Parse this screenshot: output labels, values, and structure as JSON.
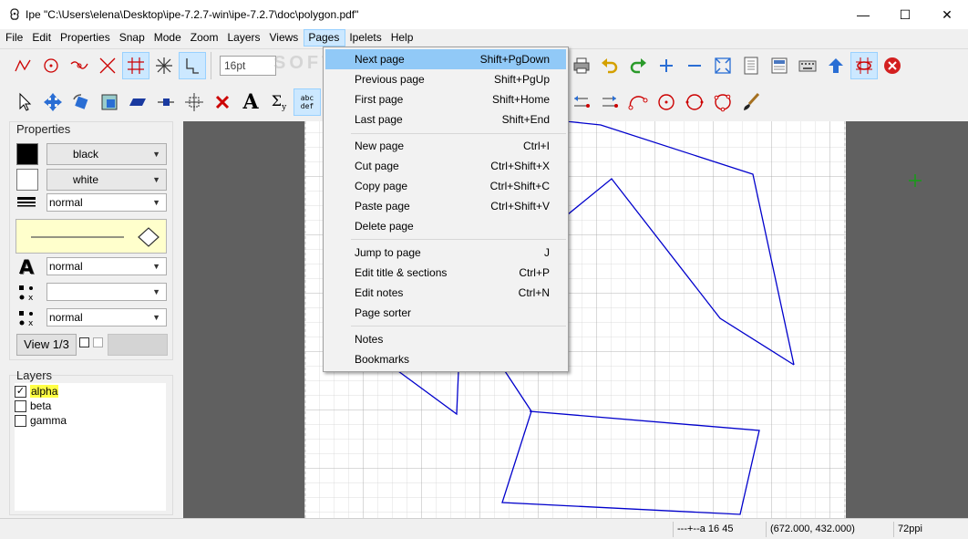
{
  "window": {
    "title": "Ipe \"C:\\Users\\elena\\Desktop\\ipe-7.2.7-win\\ipe-7.2.7\\doc\\polygon.pdf\"",
    "minimize": "—",
    "maximize": "☐",
    "close": "✕"
  },
  "menubar": [
    "File",
    "Edit",
    "Properties",
    "Snap",
    "Mode",
    "Zoom",
    "Layers",
    "Views",
    "Pages",
    "Ipelets",
    "Help"
  ],
  "toolbar": {
    "font_size": "16pt",
    "abc_label": "abc\ndef"
  },
  "properties": {
    "title": "Properties",
    "stroke_color": "black",
    "fill_color": "white",
    "pen": "normal",
    "text_size": "normal",
    "symbol_mark": "",
    "symbol_size": "normal",
    "view_label": "View 1/3"
  },
  "layers": {
    "title": "Layers",
    "items": [
      {
        "name": "alpha",
        "checked": true,
        "active": true
      },
      {
        "name": "beta",
        "checked": false,
        "active": false
      },
      {
        "name": "gamma",
        "checked": false,
        "active": false
      }
    ]
  },
  "pages_menu": {
    "items": [
      {
        "label": "Next page",
        "shortcut": "Shift+PgDown"
      },
      {
        "label": "Previous page",
        "shortcut": "Shift+PgUp"
      },
      {
        "label": "First page",
        "shortcut": "Shift+Home"
      },
      {
        "label": "Last page",
        "shortcut": "Shift+End"
      },
      {
        "label": "New page",
        "shortcut": "Ctrl+I"
      },
      {
        "label": "Cut page",
        "shortcut": "Ctrl+Shift+X"
      },
      {
        "label": "Copy page",
        "shortcut": "Ctrl+Shift+C"
      },
      {
        "label": "Paste page",
        "shortcut": "Ctrl+Shift+V"
      },
      {
        "label": "Delete page",
        "shortcut": ""
      },
      {
        "label": "Jump to page",
        "shortcut": "J"
      },
      {
        "label": "Edit title & sections",
        "shortcut": "Ctrl+P"
      },
      {
        "label": "Edit notes",
        "shortcut": "Ctrl+N"
      },
      {
        "label": "Page sorter",
        "shortcut": ""
      },
      {
        "label": "Notes",
        "shortcut": ""
      },
      {
        "label": "Bookmarks",
        "shortcut": ""
      }
    ]
  },
  "status": {
    "snap": "---+--a 16 45",
    "coords": "(672.000, 432.000)",
    "resolution": "72ppi"
  },
  "watermark": "SOFTPEDIA",
  "colors": {
    "accent": "#91c9f7",
    "polygon_stroke": "#0000cc",
    "canvas_bg": "#606060",
    "layer_highlight": "#ffff44"
  }
}
